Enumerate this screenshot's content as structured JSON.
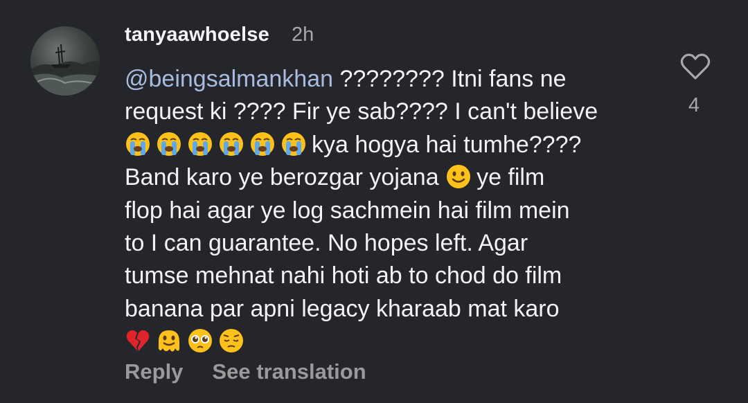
{
  "comment": {
    "username": "tanyaawhoelse",
    "timestamp": "2h",
    "mention": "@beingsalmankhan",
    "lines": {
      "l1_rest": " ???????? Itni fans ne",
      "l2": "request ki ???? Fir ye sab???? I can't believe",
      "l3_rest": "kya hogya hai tumhe????",
      "l4_a": "Band karo ye berozgar yojana",
      "l4_b": "ye film",
      "l5": "flop hai agar ye log sachmein hai film mein",
      "l6": "to I can guarantee. No hopes left. Agar",
      "l7": "tumse mehnat nahi hoti ab to chod do film",
      "l8": "banana par apni legacy kharaab mat karo"
    },
    "emojis_line3": [
      "loudly-crying-face",
      "loudly-crying-face",
      "loudly-crying-face",
      "loudly-crying-face",
      "loudly-crying-face",
      "loudly-crying-face"
    ],
    "emoji_line4": "slightly-smiling-face",
    "emojis_line9": [
      "broken-heart",
      "melting-face",
      "pleading-face",
      "pensive-face"
    ]
  },
  "like": {
    "icon": "heart-outline-icon",
    "count": "4"
  },
  "actions": {
    "reply_label": "Reply",
    "translate_label": "See translation"
  },
  "colors": {
    "background": "#24262b",
    "text": "#f3f3f3",
    "mention": "#a9bcdf",
    "muted": "#9a9a9a"
  }
}
